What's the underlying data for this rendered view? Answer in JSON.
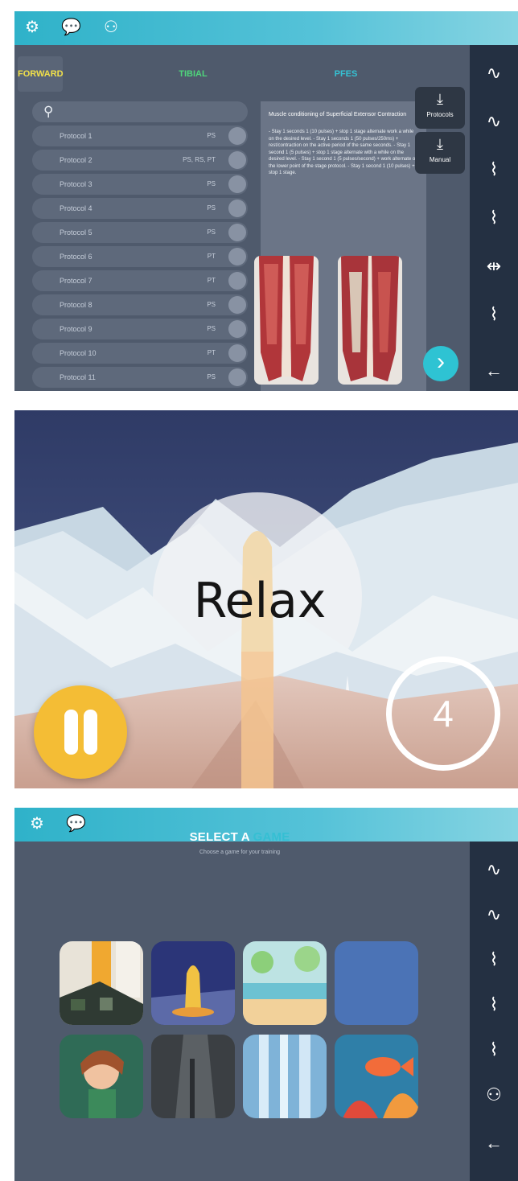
{
  "screen1": {
    "tabs": [
      {
        "label": "FORWARD",
        "color": "#f1e04a"
      },
      {
        "label": "TIBIAL",
        "color": "#4fd47b"
      },
      {
        "label": "PFES",
        "color": "#35c2d4"
      }
    ],
    "protocols": [
      {
        "label": "Protocol 1",
        "meta": "PS"
      },
      {
        "label": "Protocol 2",
        "meta": "PS, RS, PT"
      },
      {
        "label": "Protocol 3",
        "meta": "PS"
      },
      {
        "label": "Protocol 4",
        "meta": "PS"
      },
      {
        "label": "Protocol 5",
        "meta": "PS"
      },
      {
        "label": "Protocol 6",
        "meta": "PT"
      },
      {
        "label": "Protocol 7",
        "meta": "PT"
      },
      {
        "label": "Protocol 8",
        "meta": "PS"
      },
      {
        "label": "Protocol 9",
        "meta": "PS"
      },
      {
        "label": "Protocol 10",
        "meta": "PT"
      },
      {
        "label": "Protocol 11",
        "meta": "PS"
      }
    ],
    "description_title": "Muscle conditioning of Superficial Extensor Contraction",
    "description_text": "- Stay 1 seconds 1 (10 pulses) + stop 1 stage alternate work a while on the desired level. - Stay 1 seconds 1 (50 pulses/250ms) + rest/contraction on the active period of the same seconds. - Stay 1 second 1 (5 pulses) + stop 1 stage alternate with a while on the desired level. - Stay 1 second 1 (5 pulses/second) + work alternate on the lower point of the stage protocol. - Stay 1 second 1 (10 pulses) + stop 1 stage.",
    "buttons": {
      "protocols": "Protocols",
      "manual": "Manual",
      "next_glyph": "›"
    },
    "topbar_icons": [
      "gear-icon",
      "chat-icon",
      "users-icon"
    ],
    "rail_icons": [
      "emg-pulse-icon",
      "emg-wave-icon",
      "stimulation-icon",
      "stimulation-alt-icon",
      "stimulation-bidirectional-icon",
      "stimulation-strong-icon",
      "back-arrow-icon"
    ]
  },
  "screen2": {
    "prompt": "Relax",
    "countdown": "4"
  },
  "screen3": {
    "title_main": "SELECT A ",
    "title_accent": "GAME",
    "subtitle": "Choose a game for your training",
    "topbar_icons": [
      "gear-icon",
      "chat-icon"
    ],
    "games": [
      {
        "name": "game-tile-city"
      },
      {
        "name": "game-tile-rocket"
      },
      {
        "name": "game-tile-beach"
      },
      {
        "name": "game-tile-blank"
      },
      {
        "name": "game-tile-girl"
      },
      {
        "name": "game-tile-cave"
      },
      {
        "name": "game-tile-waterfall"
      },
      {
        "name": "game-tile-fish"
      }
    ],
    "rail_icons": [
      "emg-pulse-icon",
      "emg-wave-icon",
      "stimulation-icon",
      "stimulation-alt-icon",
      "stimulation-strong-icon",
      "users-icon",
      "back-arrow-icon"
    ]
  },
  "colors": {
    "topbar": "#2fb2c9",
    "panel_bg": "#4f5a6c",
    "rail_bg": "#243042",
    "accent": "#35bfd3",
    "pause": "#f4bd35"
  }
}
